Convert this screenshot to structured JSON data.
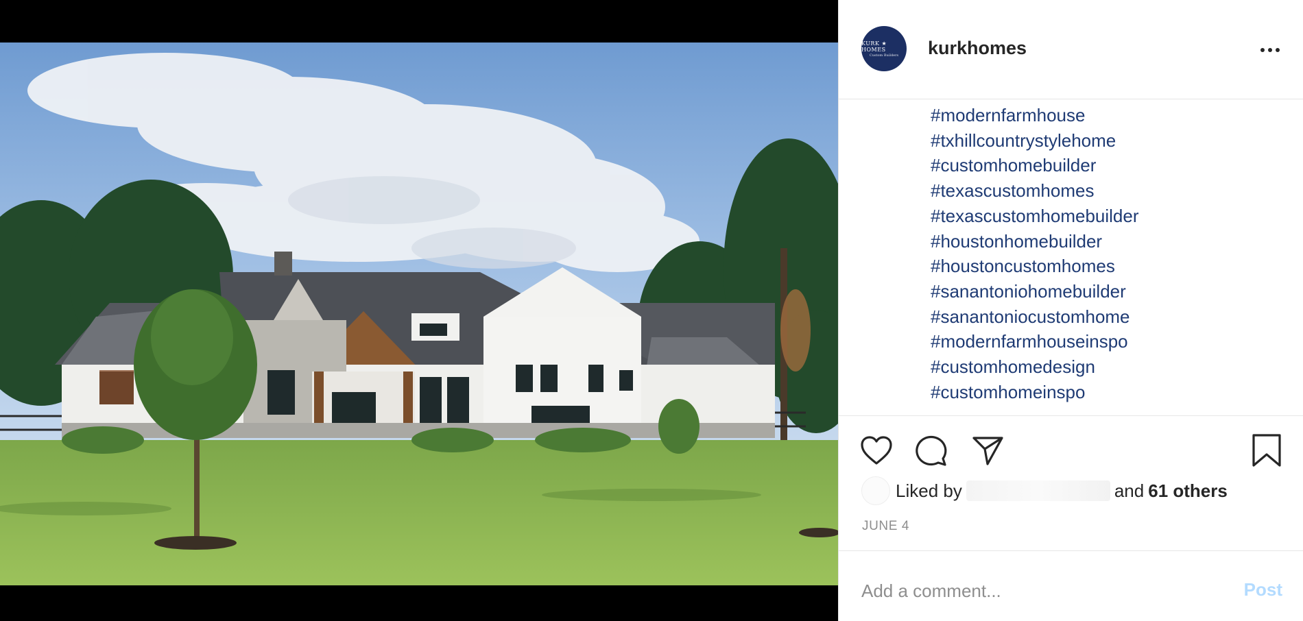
{
  "post": {
    "username": "kurkhomes",
    "avatar": {
      "line1": "KURK ★ HOMES",
      "line2": "Custom Builders",
      "bg_color": "#1c2f63"
    },
    "more_icon": "ellipsis-icon",
    "caption_hashtags": [
      "#modernfarmhouse",
      "#txhillcountrystylehome",
      "#customhomebuilder",
      "#texascustomhomes",
      "#texascustomhomebuilder",
      "#houstonhomebuilder",
      "#houstoncustomhomes",
      "#sanantoniohomebuilder",
      "#sanantoniocustomhome",
      "#modernfarmhouseinspo",
      "#customhomedesign",
      "#customhomeinspo"
    ],
    "actions": {
      "like_icon": "heart-icon",
      "comment_icon": "comment-icon",
      "share_icon": "paper-plane-icon",
      "save_icon": "bookmark-icon"
    },
    "likes": {
      "prefix": "Liked by",
      "middle": "and",
      "others": "61 others"
    },
    "date": "JUNE 4",
    "comment": {
      "placeholder": "Add a comment...",
      "post_label": "Post"
    }
  },
  "colors": {
    "hashtag": "#1f3b74",
    "post_button": "#b3dbff",
    "muted": "#8e8e8e",
    "text": "#262626"
  }
}
